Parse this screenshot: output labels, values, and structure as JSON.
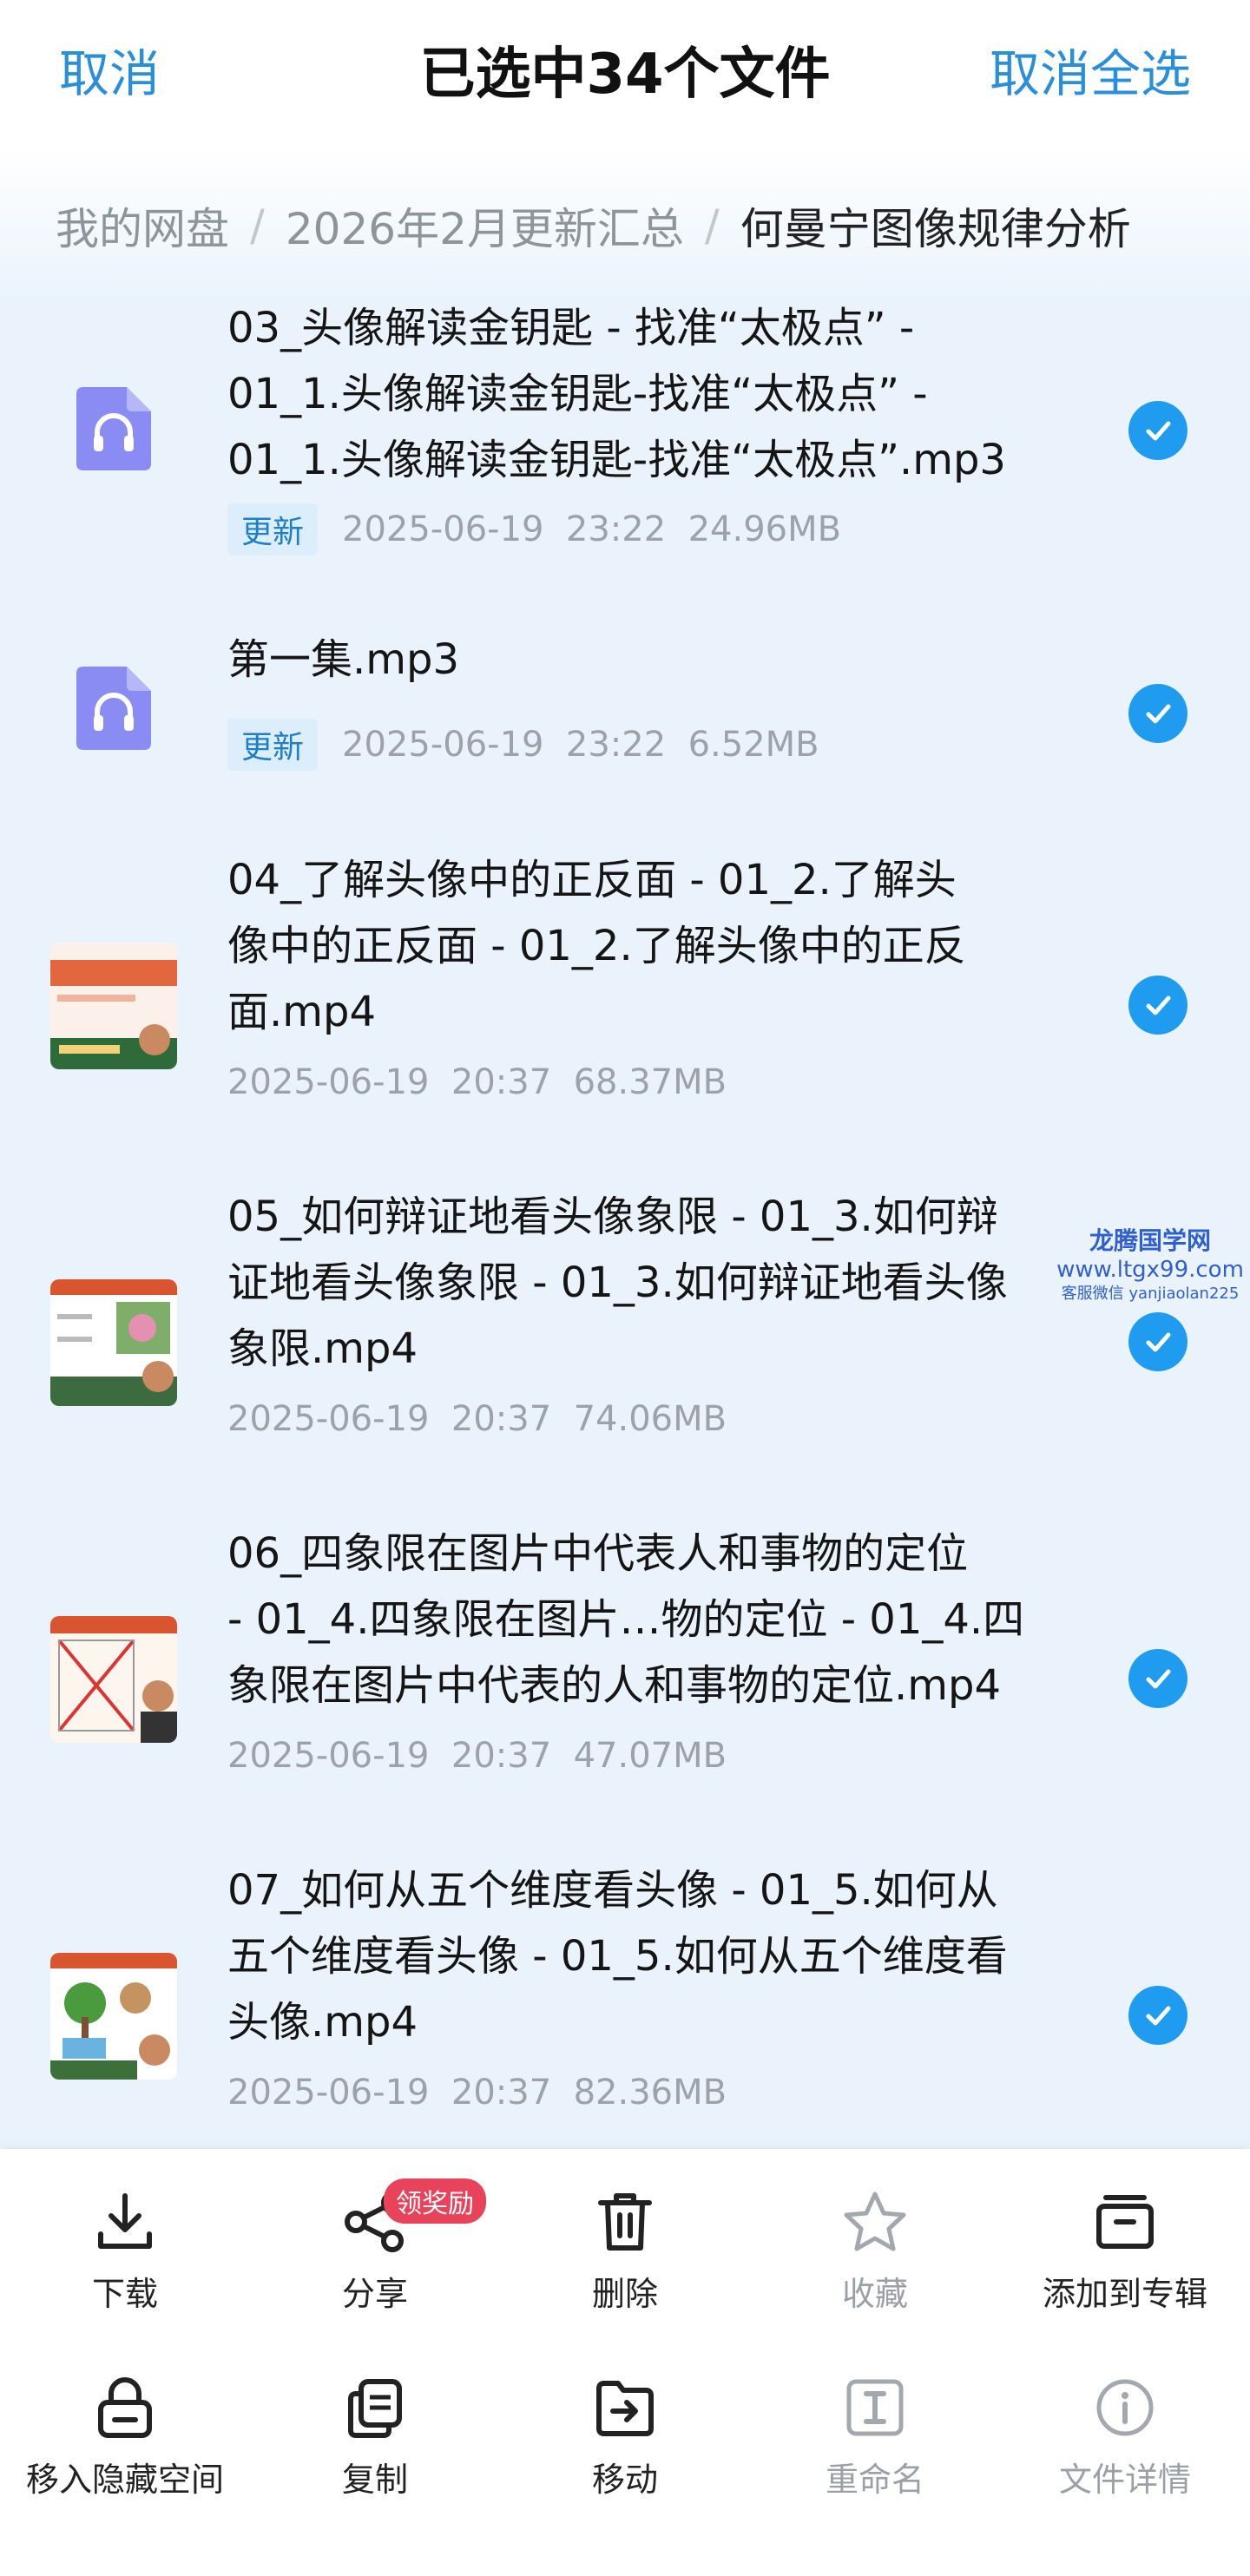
{
  "header": {
    "cancel_label": "取消",
    "title": "已选中34个文件",
    "deselect_all_label": "取消全选"
  },
  "breadcrumb": {
    "items": [
      "我的网盘",
      "2026年2月更新汇总",
      "何曼宁图像规律分析"
    ],
    "separator": "/"
  },
  "files": [
    {
      "name_lines": [
        "03_头像解读金钥匙 - 找准“太极点” -",
        "01_1.头像解读金钥匙-找准“太极点” -",
        "01_1.头像解读金钥匙-找准“太极点”.mp3"
      ],
      "badge": "更新",
      "meta": "2025-06-19  23:22  24.96MB",
      "type": "audio-icon",
      "selected": true
    },
    {
      "name_lines": [
        "第一集.mp3"
      ],
      "badge": "更新",
      "meta": "2025-06-19  23:22  6.52MB",
      "type": "audio-icon",
      "selected": true
    },
    {
      "name_lines": [
        "04_了解头像中的正反面 - 01_2.了解头",
        "像中的正反面 - 01_2.了解头像中的正反",
        "面.mp4"
      ],
      "badge": "",
      "meta": "2025-06-19  20:37  68.37MB",
      "type": "video-thumbnail",
      "selected": true
    },
    {
      "name_lines": [
        "05_如何辩证地看头像象限 - 01_3.如何辩",
        "证地看头像象限 - 01_3.如何辩证地看头像",
        "象限.mp4"
      ],
      "badge": "",
      "meta": "2025-06-19  20:37  74.06MB",
      "type": "video-thumbnail",
      "selected": true
    },
    {
      "name_lines": [
        "06_四象限在图片中代表人和事物的定位",
        "- 01_4.四象限在图片…物的定位 - 01_4.四",
        "象限在图片中代表的人和事物的定位.mp4"
      ],
      "badge": "",
      "meta": "2025-06-19  20:37  47.07MB",
      "type": "video-thumbnail",
      "selected": true
    },
    {
      "name_lines": [
        "07_如何从五个维度看头像 - 01_5.如何从",
        "五个维度看头像 - 01_5.如何从五个维度看",
        "头像.mp4"
      ],
      "badge": "",
      "meta": "2025-06-19  20:37  82.36MB",
      "type": "video-thumbnail",
      "selected": true
    }
  ],
  "watermark": {
    "line1": "龙腾国学网",
    "line2": "www.ltgx99.com",
    "line3": "客服微信 yanjiaolan225"
  },
  "toolbar": {
    "row1": [
      {
        "label": "下载",
        "icon": "download-icon",
        "enabled": true
      },
      {
        "label": "分享",
        "icon": "share-icon",
        "enabled": true,
        "badge": "领奖励"
      },
      {
        "label": "删除",
        "icon": "trash-icon",
        "enabled": true
      },
      {
        "label": "收藏",
        "icon": "star-icon",
        "enabled": false
      },
      {
        "label": "添加到专辑",
        "icon": "album-icon",
        "enabled": true
      }
    ],
    "row2": [
      {
        "label": "移入隐藏空间",
        "icon": "lock-icon",
        "enabled": true
      },
      {
        "label": "复制",
        "icon": "copy-icon",
        "enabled": true
      },
      {
        "label": "移动",
        "icon": "move-icon",
        "enabled": true
      },
      {
        "label": "重命名",
        "icon": "rename-icon",
        "enabled": false
      },
      {
        "label": "文件详情",
        "icon": "info-icon",
        "enabled": false
      }
    ]
  },
  "colors": {
    "accent": "#2a8fd9",
    "check": "#1f9cf0",
    "list_bg": "#eaf3fc",
    "badge_red": "#e8435a"
  }
}
